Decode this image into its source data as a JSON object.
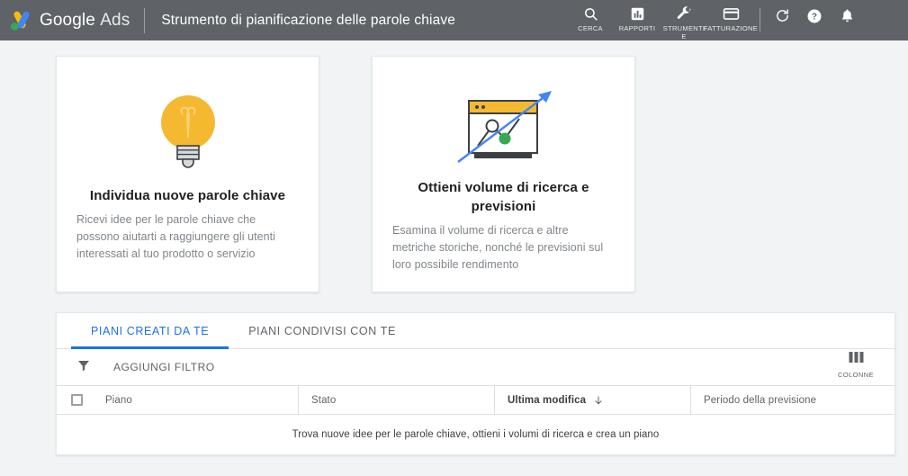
{
  "header": {
    "brand_primary": "Google",
    "brand_secondary": "Ads",
    "page_title": "Strumento di pianificazione delle parole chiave",
    "logo_icon": "google-ads-logo",
    "tools": [
      {
        "label": "CERCA",
        "icon": "search-icon"
      },
      {
        "label": "RAPPORTI",
        "icon": "reports-bar-chart-icon"
      },
      {
        "label": "STRUMENTI\nE\nIMPOSTAZIONI",
        "icon": "wrench-tools-icon"
      },
      {
        "label": "FATTURAZIONE",
        "icon": "credit-card-billing-icon"
      }
    ],
    "actions": [
      {
        "name": "refresh",
        "icon": "refresh-icon"
      },
      {
        "name": "help",
        "icon": "help-circle-icon"
      },
      {
        "name": "notifications",
        "icon": "bell-icon"
      }
    ],
    "background_color": "#5f6368"
  },
  "cards": [
    {
      "icon": "lightbulb-icon",
      "title": "Individua nuove parole chiave",
      "description": "Ricevi idee per le parole chiave che possono aiutarti a raggiungere gli utenti interessati al tuo prodotto o servizio"
    },
    {
      "icon": "search-volume-forecast-icon",
      "title": "Ottieni volume di ricerca e previsioni",
      "description": "Esamina il volume di ricerca e altre metriche storiche, nonché le previsioni sul loro possibile rendimento"
    }
  ],
  "plans": {
    "tabs": [
      {
        "label": "Piani creati da te",
        "active": true
      },
      {
        "label": "Piani condivisi con te",
        "active": false
      }
    ],
    "filter": {
      "icon": "filter-funnel-icon",
      "label": "Aggiungi filtro"
    },
    "columns_button": {
      "icon": "columns-icon",
      "label": "Colonne"
    },
    "table": {
      "columns": [
        {
          "label": "Piano",
          "sorted": false
        },
        {
          "label": "Stato",
          "sorted": false
        },
        {
          "label": "Ultima modifica",
          "sorted": true,
          "sort_direction": "desc"
        },
        {
          "label": "Periodo della previsione",
          "sorted": false
        }
      ],
      "empty_message": "Trova nuove idee per le parole chiave, ottieni i volumi di ricerca e crea un piano"
    }
  },
  "colors": {
    "header_bg": "#5f6368",
    "page_bg": "#f1f3f4",
    "accent_blue": "#1a73e8",
    "lightbulb_yellow": "#f5b931",
    "chart_green": "#34a853",
    "arrow_blue": "#4285f4"
  }
}
